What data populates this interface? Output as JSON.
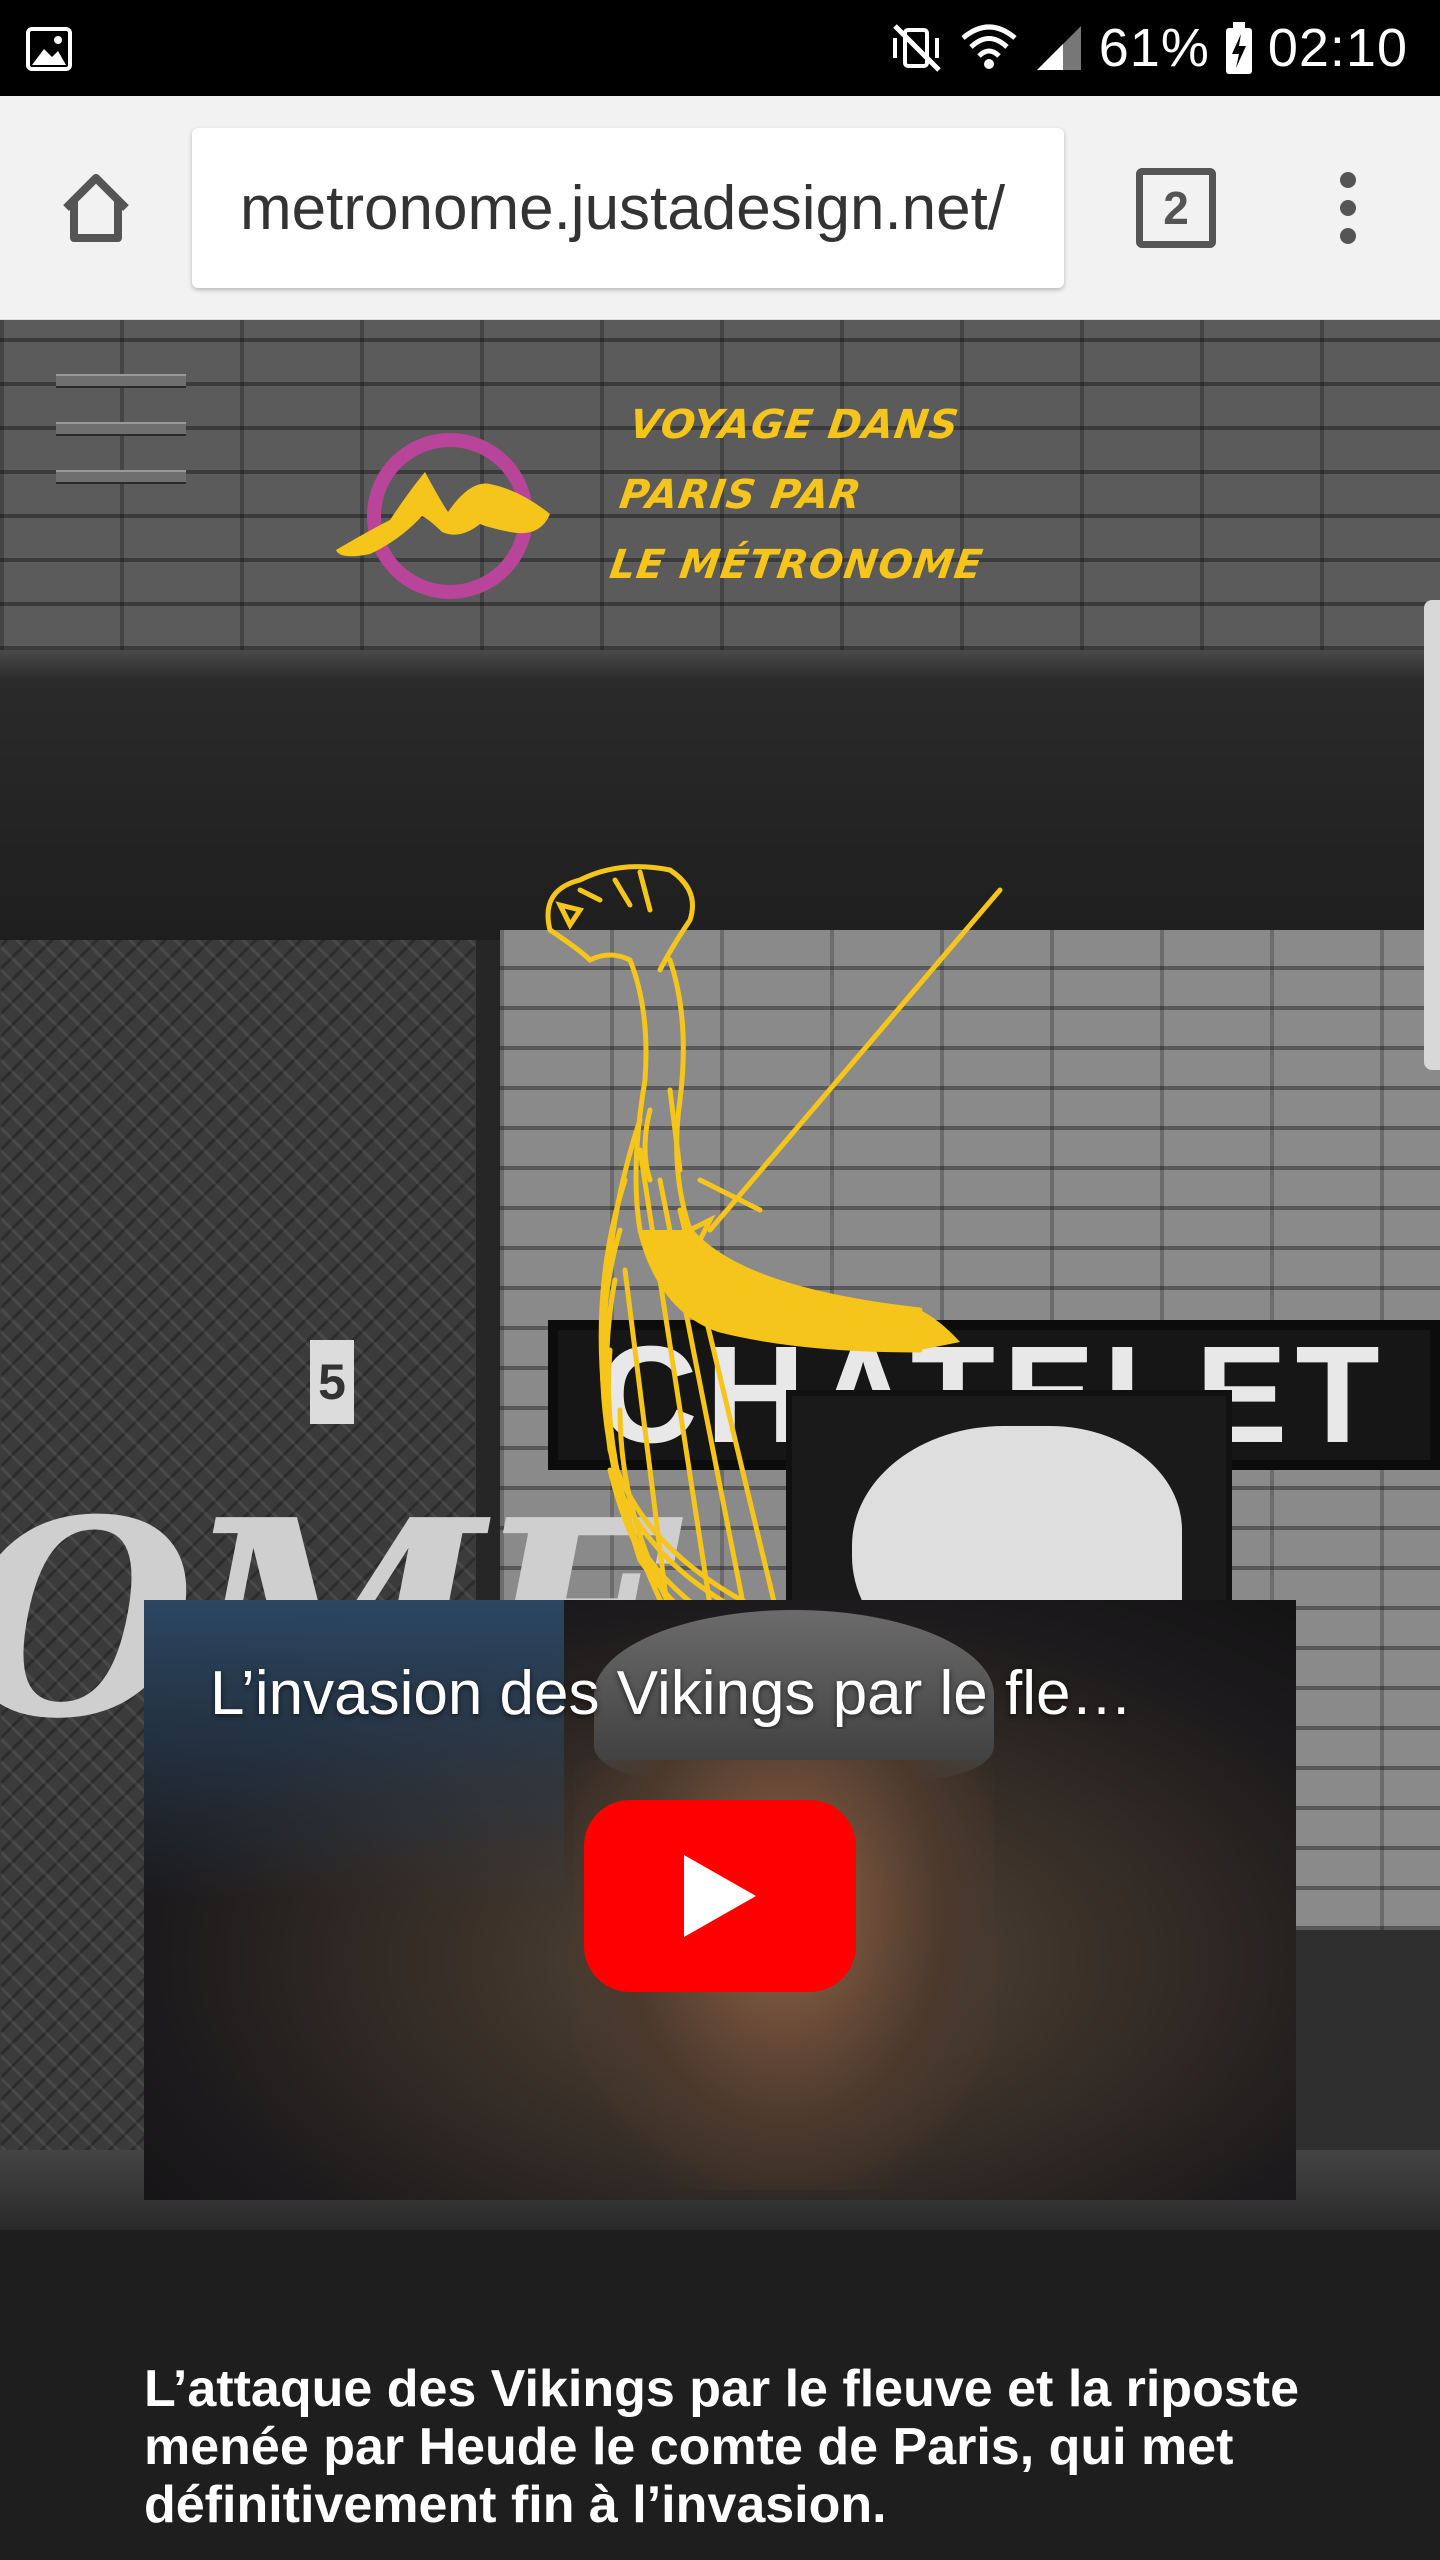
{
  "status_bar": {
    "battery": "61%",
    "time": "02:10",
    "icons": [
      "image-notification-icon",
      "vibrate-mute-icon",
      "wifi-icon",
      "cell-signal-icon",
      "battery-charging-icon"
    ]
  },
  "browser": {
    "url": "metronome.justadesign.net/",
    "tab_count": "2",
    "icons": [
      "home-icon",
      "tabs-icon",
      "overflow-menu-icon"
    ]
  },
  "site_header": {
    "tagline_lines": [
      "VOYAGE DANS",
      "PARIS PAR",
      "LE MÉTRONOME"
    ],
    "accent_color": "#f5c51c",
    "logo_colors": [
      "#f5c51c",
      "#b8459a"
    ]
  },
  "background_scene": {
    "station_sign": "CHATELET",
    "poster_word": "OME",
    "poster_number": "5"
  },
  "video": {
    "title": "L’invasion des Vikings par le fle…",
    "play_button_color": "#ff0000"
  },
  "caption": "L’attaque des Vikings par le fleuve et la riposte menée par Heude le comte de Paris, qui met définitivement fin à l’invasion."
}
